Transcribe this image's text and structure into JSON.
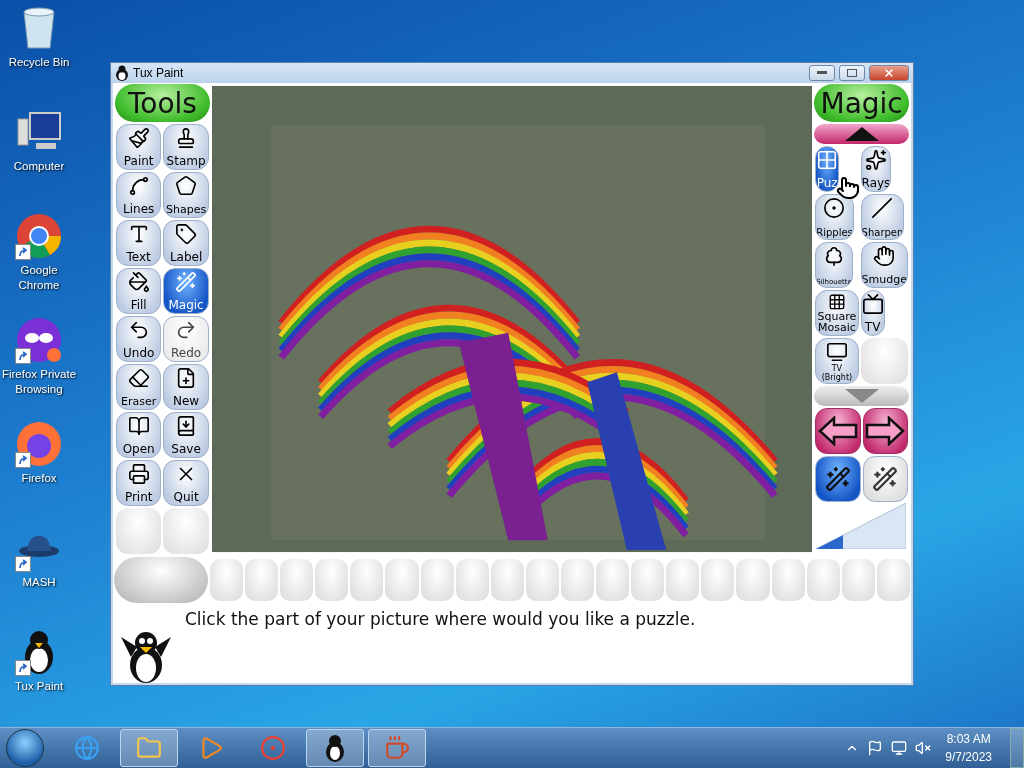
{
  "desktop_icons": [
    {
      "label": "Recycle Bin",
      "shortcut": false
    },
    {
      "label": "Computer",
      "shortcut": false
    },
    {
      "label": "Google Chrome",
      "shortcut": true
    },
    {
      "label": "Firefox Private Browsing",
      "shortcut": true
    },
    {
      "label": "Firefox",
      "shortcut": true
    },
    {
      "label": "MASH",
      "shortcut": true
    },
    {
      "label": "Tux Paint",
      "shortcut": true
    }
  ],
  "window": {
    "title": "Tux Paint"
  },
  "tools": {
    "title": "Tools",
    "items": [
      {
        "label": "Paint",
        "selected": false,
        "disabled": false
      },
      {
        "label": "Stamp",
        "selected": false,
        "disabled": false
      },
      {
        "label": "Lines",
        "selected": false,
        "disabled": false
      },
      {
        "label": "Shapes",
        "selected": false,
        "disabled": false
      },
      {
        "label": "Text",
        "selected": false,
        "disabled": false
      },
      {
        "label": "Label",
        "selected": false,
        "disabled": false
      },
      {
        "label": "Fill",
        "selected": false,
        "disabled": false
      },
      {
        "label": "Magic",
        "selected": true,
        "disabled": false
      },
      {
        "label": "Undo",
        "selected": false,
        "disabled": false
      },
      {
        "label": "Redo",
        "selected": false,
        "disabled": true
      },
      {
        "label": "Eraser",
        "selected": false,
        "disabled": false
      },
      {
        "label": "New",
        "selected": false,
        "disabled": false
      },
      {
        "label": "Open",
        "selected": false,
        "disabled": false
      },
      {
        "label": "Save",
        "selected": false,
        "disabled": false
      },
      {
        "label": "Print",
        "selected": false,
        "disabled": false
      },
      {
        "label": "Quit",
        "selected": false,
        "disabled": false
      }
    ]
  },
  "magic": {
    "title": "Magic",
    "scroll_up": {
      "disabled": false
    },
    "scroll_down": {
      "disabled": true
    },
    "items": [
      {
        "label": "Puz",
        "selected": true
      },
      {
        "label": "Rays",
        "selected": false
      },
      {
        "label": "Ripples",
        "selected": false
      },
      {
        "label": "Sharpen",
        "selected": false
      },
      {
        "label": "Silhouette",
        "selected": false
      },
      {
        "label": "Smudge",
        "selected": false
      },
      {
        "label": "Square Mosaic",
        "selected": false
      },
      {
        "label": "TV",
        "selected": false
      },
      {
        "label": "TV (Bright)",
        "selected": false
      }
    ],
    "modes": [
      {
        "selected": true
      },
      {
        "selected": false
      }
    ],
    "size": {
      "level": 0.3
    }
  },
  "instruction": "Click the part of your picture where would you like a puzzle.",
  "taskbar": {
    "apps": [
      {
        "active": false
      },
      {
        "active": true
      },
      {
        "active": false
      },
      {
        "active": false
      },
      {
        "active": true
      },
      {
        "active": true
      }
    ],
    "time": "8:03 AM",
    "date": "9/7/2023"
  }
}
